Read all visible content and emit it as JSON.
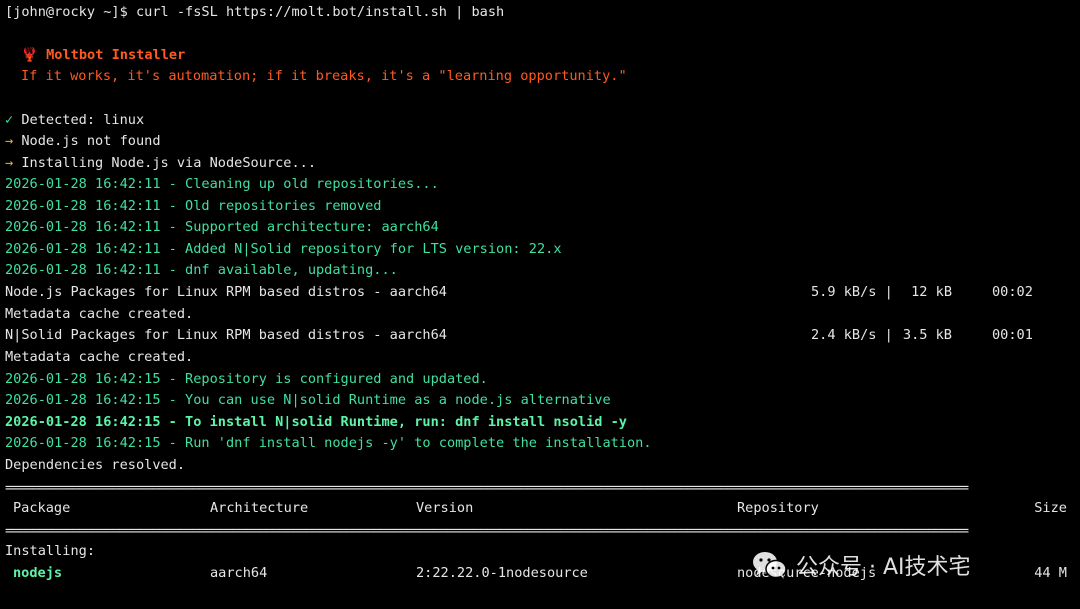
{
  "prompt": "[john@rocky ~]$ curl -fsSL https://molt.bot/install.sh | bash",
  "installer": {
    "icon": "lobster-icon",
    "icon_glyph": "🦞",
    "title": "Moltbot Installer",
    "tagline": "If it works, it's automation; if it breaks, it's a \"learning opportunity.\""
  },
  "status": [
    {
      "marker": "✓",
      "text": "Detected: linux"
    },
    {
      "marker": "→",
      "text": "Node.js not found"
    },
    {
      "marker": "→",
      "text": "Installing Node.js via NodeSource..."
    }
  ],
  "log1": [
    "2026-01-28 16:42:11 - Cleaning up old repositories...",
    "2026-01-28 16:42:11 - Old repositories removed",
    "2026-01-28 16:42:11 - Supported architecture: aarch64",
    "2026-01-28 16:42:11 - Added N|Solid repository for LTS version: 22.x",
    "2026-01-28 16:42:11 - dnf available, updating..."
  ],
  "repos": [
    {
      "name": "Node.js Packages for Linux RPM based distros - aarch64",
      "speed": "5.9 kB/s |",
      "size": "12 kB",
      "time": "00:02",
      "cache": "Metadata cache created."
    },
    {
      "name": "N|Solid Packages for Linux RPM based distros - aarch64",
      "speed": "2.4 kB/s |",
      "size": "3.5 kB",
      "time": "00:01",
      "cache": "Metadata cache created."
    }
  ],
  "log2": [
    "2026-01-28 16:42:15 - Repository is configured and updated.",
    "2026-01-28 16:42:15 - You can use N|solid Runtime as a node.js alternative"
  ],
  "log_bold": "2026-01-28 16:42:15 - To install N|solid Runtime, run: dnf install nsolid -y",
  "log3": "2026-01-28 16:42:15 - Run 'dnf install nodejs -y' to complete the installation.",
  "deps": "Dependencies resolved.",
  "table": {
    "headers": {
      "package": "Package",
      "arch": "Architecture",
      "version": "Version",
      "repo": "Repository",
      "size": "Size"
    },
    "section": "Installing:",
    "row": {
      "package": "nodejs",
      "arch": "aarch64",
      "version": "2:22.22.0-1nodesource",
      "repo": "nodesource-nodejs",
      "size": "44 M"
    }
  },
  "watermark": {
    "icon": "wechat-icon",
    "text": "公众号 · AI技术宅"
  },
  "colors": {
    "background": "#000000",
    "text": "#e6e6e6",
    "installer_orange": "#ff5a1f",
    "log_green": "#3fe0a0",
    "arrow_yellow": "#ffb020"
  }
}
